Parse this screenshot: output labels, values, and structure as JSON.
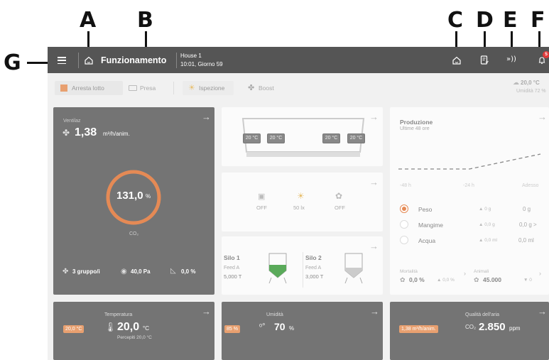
{
  "callouts": {
    "a": "A",
    "b": "B",
    "c": "C",
    "d": "D",
    "e": "E",
    "f": "F",
    "g": "G"
  },
  "topbar": {
    "title": "Funzionamento",
    "house": "House 1",
    "datetime": "10:01, Giorno 59",
    "notification_count": "5",
    "icons": {
      "menu": "menu-icon",
      "home": "home-icon",
      "house": "house-icon",
      "report": "report-icon",
      "signal": "signal-icon",
      "bell": "bell-icon"
    }
  },
  "toolbar": {
    "stop_batch": "Arresta lotto",
    "intake": "Presa",
    "inspection": "Ispezione",
    "boost": "Boost",
    "outside_temp": "20,0 °C",
    "humidity": "Umidità 72 %"
  },
  "ventilation": {
    "label": "Ventilaz",
    "value": "1,38",
    "unit": "m³/h/anim.",
    "ring_value": "131,0",
    "ring_unit": "%",
    "ring_fraction": 1.0,
    "ring_sub": "CO₂",
    "groups": "3 gruppo/i",
    "pressure": "40,0 Pa",
    "opening": "0,0 %"
  },
  "sensors": {
    "t1": "20 °C",
    "t2": "20 °C",
    "t3": "20 °C",
    "t4": "20 °C"
  },
  "devices": [
    {
      "state": "OFF"
    },
    {
      "state": "50 lx"
    },
    {
      "state": "OFF"
    }
  ],
  "silos": [
    {
      "name": "Silo 1",
      "feed": "Feed A",
      "amount": "5,000 T",
      "level": 0.45
    },
    {
      "name": "Silo 2",
      "feed": "Feed A",
      "amount": "3,000 T",
      "level": 0.3
    }
  ],
  "production": {
    "title": "Produzione",
    "subtitle": "Ultime 48 ore",
    "axis": [
      "-48 h",
      "-24 h",
      "Adesso"
    ],
    "rows": [
      {
        "name": "Peso",
        "delta": "▲ 0 g",
        "value": "0 g",
        "selected": true
      },
      {
        "name": "Mangime",
        "delta": "▲ 0,0 g",
        "value": "0,0 g >",
        "selected": false
      },
      {
        "name": "Acqua",
        "delta": "▲ 0,0 ml",
        "value": "0,0 ml",
        "selected": false
      }
    ],
    "mortality_label": "Mortalità",
    "mortality": "0,0 %",
    "mortality_delta": "▲ 0,0 %",
    "animals_label": "Animali",
    "animals": "45.000",
    "animals_delta": "▼ 0"
  },
  "bottom": {
    "temp_title": "Temperatura",
    "temp_badge": "20,0 °C",
    "temp_value": "20,0",
    "temp_unit": "°C",
    "temp_perceived": "Percepiti 20,0 °C",
    "hum_title": "Umidità",
    "hum_badge": "85 %",
    "hum_value": "70",
    "hum_unit": "%",
    "air_title": "Qualità dell'aria",
    "air_badge": "1,38 m³/h/anim.",
    "air_prefix": "CO₂",
    "air_value": "2.850",
    "air_unit": "ppm"
  },
  "colors": {
    "topbar": "#555555",
    "accent": "#e58a55",
    "badge": "#e03a3a"
  }
}
